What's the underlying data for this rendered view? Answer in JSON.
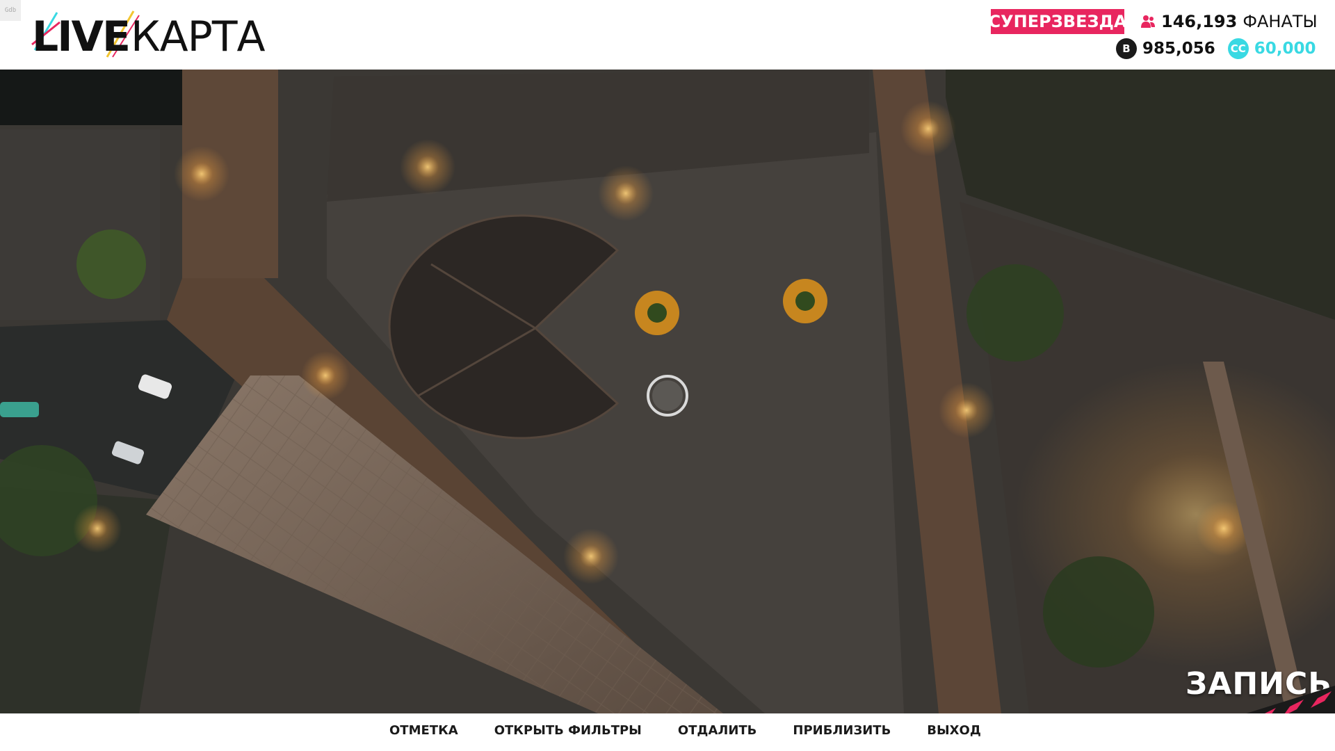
{
  "header": {
    "logo_live": "LIVE",
    "logo_karta": "КАРТА",
    "corner_tag": "Gdb",
    "rank": "СУПЕРЗВЕЗДА",
    "fans_count": "146,193",
    "fans_label": "ФАНАТЫ",
    "cash": "985,056",
    "cash_coin_symbol": "B",
    "cc_amount": "60,000",
    "cc_coin_symbol": "CC"
  },
  "overlay": {
    "recording_label": "ЗАПИСЬ"
  },
  "actions": [
    {
      "label": "ОТМЕТКА"
    },
    {
      "label": "ОТКРЫТЬ ФИЛЬТРЫ"
    },
    {
      "label": "ОТДАЛИТЬ"
    },
    {
      "label": "ПРИБЛИЗИТЬ"
    },
    {
      "label": "ВЫХОД"
    }
  ],
  "colors": {
    "accent_pink": "#e8265f",
    "cc_cyan": "#39d9e3"
  },
  "icons": {
    "fans": "people-icon",
    "cash": "coin-icon",
    "cc": "cc-coin-icon",
    "cursor": "map-cursor-icon"
  }
}
